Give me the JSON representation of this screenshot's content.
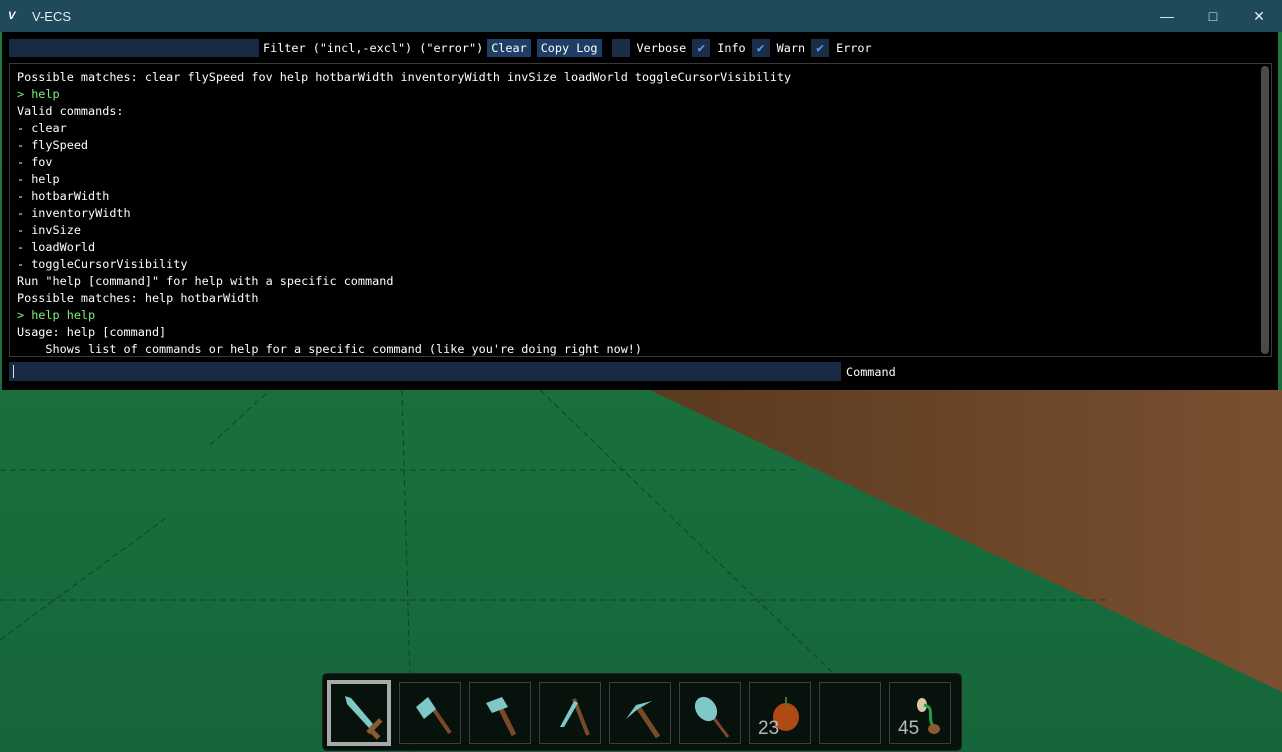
{
  "window": {
    "title": "V-ECS",
    "logo": "V-ECS",
    "controls": [
      "minimize-icon",
      "maximize-icon",
      "close-icon"
    ]
  },
  "toolbar": {
    "filter_value": "",
    "filter_label": "Filter (\"incl,-excl\") (\"error\")",
    "clear_label": "Clear",
    "copy_label": "Copy Log",
    "checkboxes": [
      {
        "label": "Verbose",
        "checked": false
      },
      {
        "label": "Info",
        "checked": true
      },
      {
        "label": "Warn",
        "checked": true
      },
      {
        "label": "Error",
        "checked": true
      }
    ]
  },
  "log": [
    {
      "text": "Possible matches: clear flySpeed fov help hotbarWidth inventoryWidth invSize loadWorld toggleCursorVisibility",
      "type": "info"
    },
    {
      "text": "> help",
      "type": "command"
    },
    {
      "text": "Valid commands:",
      "type": "info"
    },
    {
      "text": "- clear",
      "type": "info"
    },
    {
      "text": "- flySpeed",
      "type": "info"
    },
    {
      "text": "- fov",
      "type": "info"
    },
    {
      "text": "- help",
      "type": "info"
    },
    {
      "text": "- hotbarWidth",
      "type": "info"
    },
    {
      "text": "- inventoryWidth",
      "type": "info"
    },
    {
      "text": "- invSize",
      "type": "info"
    },
    {
      "text": "- loadWorld",
      "type": "info"
    },
    {
      "text": "- toggleCursorVisibility",
      "type": "info"
    },
    {
      "text": "Run \"help [command]\" for help with a specific command",
      "type": "info"
    },
    {
      "text": "Possible matches: help hotbarWidth",
      "type": "info"
    },
    {
      "text": "> help help",
      "type": "command"
    },
    {
      "text": "Usage: help [command]",
      "type": "info"
    },
    {
      "text": "    Shows list of commands or help for a specific command (like you're doing right now!)",
      "type": "info"
    }
  ],
  "command": {
    "value": "",
    "label": "Command"
  },
  "hotbar": {
    "selected": 0,
    "slots": [
      {
        "item": "sword-icon",
        "count": ""
      },
      {
        "item": "axe-icon",
        "count": ""
      },
      {
        "item": "hammer-icon",
        "count": ""
      },
      {
        "item": "scythe-icon",
        "count": ""
      },
      {
        "item": "pickaxe-icon",
        "count": ""
      },
      {
        "item": "shovel-icon",
        "count": ""
      },
      {
        "item": "apple-icon",
        "count": "23"
      },
      {
        "item": "",
        "count": ""
      },
      {
        "item": "seed-icon",
        "count": "45"
      }
    ]
  },
  "colors": {
    "titlebar": "#1f4a5a",
    "command_text": "#7cf07c",
    "input_bg": "#192a45",
    "button_bg": "#1e3e66",
    "check": "#4a9cf0",
    "grass": "#1a6b3a",
    "dirt": "#6b4526"
  }
}
